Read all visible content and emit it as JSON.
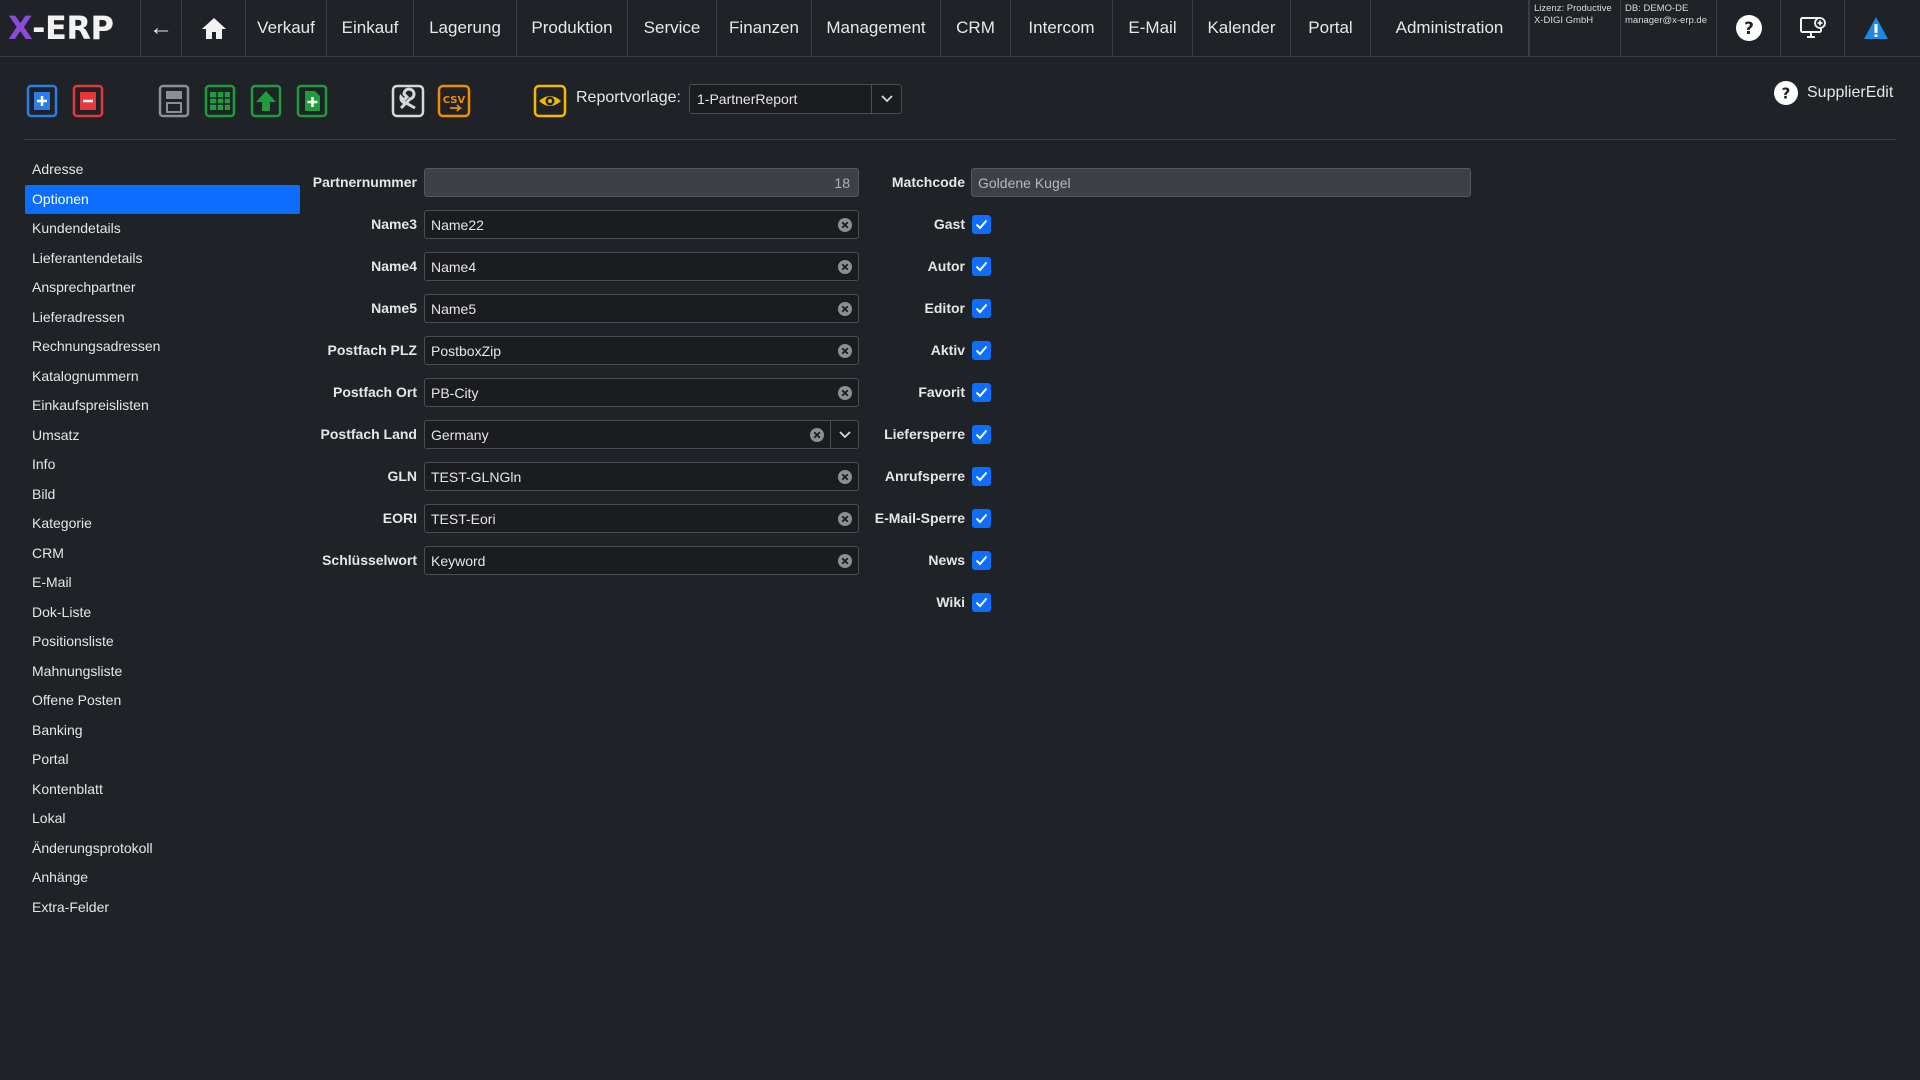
{
  "app": {
    "logo_x": "X",
    "logo_rest": "-ERP"
  },
  "nav": {
    "back": "←",
    "items": [
      "Verkauf",
      "Einkauf",
      "Lagerung",
      "Produktion",
      "Service",
      "Finanzen",
      "Management",
      "CRM",
      "Intercom",
      "E-Mail",
      "Kalender",
      "Portal",
      "Administration"
    ],
    "license_line1": "Lizenz: Productive",
    "license_line2": "X-DIGI GmbH",
    "db_line1": "DB: DEMO-DE",
    "db_line2": "manager@x-erp.de"
  },
  "toolbar": {
    "report_label": "Reportvorlage:",
    "report_value": "1-PartnerReport",
    "help_label": "SupplierEdit",
    "icons": [
      "new-document-icon",
      "delete-document-icon",
      "save-icon",
      "table-icon",
      "upload-icon",
      "add-file-icon",
      "wrench-icon",
      "csv-icon",
      "eye-icon"
    ]
  },
  "sidebar": {
    "items": [
      "Adresse",
      "Optionen",
      "Kundendetails",
      "Lieferantendetails",
      "Ansprechpartner",
      "Lieferadressen",
      "Rechnungsadressen",
      "Katalognummern",
      "Einkaufspreislisten",
      "Umsatz",
      "Info",
      "Bild",
      "Kategorie",
      "CRM",
      "E-Mail",
      "Dok-Liste",
      "Positionsliste",
      "Mahnungsliste",
      "Offene Posten",
      "Banking",
      "Portal",
      "Kontenblatt",
      "Lokal",
      "Änderungsprotokoll",
      "Anhänge",
      "Extra-Felder"
    ],
    "active": "Optionen"
  },
  "form": {
    "partnernummer_label": "Partnernummer",
    "partnernummer_value": "18",
    "matchcode_label": "Matchcode",
    "matchcode_value": "Goldene Kugel",
    "fields": [
      {
        "label": "Name3",
        "value": "Name22"
      },
      {
        "label": "Name4",
        "value": "Name4"
      },
      {
        "label": "Name5",
        "value": "Name5"
      },
      {
        "label": "Postfach PLZ",
        "value": "PostboxZip"
      },
      {
        "label": "Postfach Ort",
        "value": "PB-City"
      },
      {
        "label": "Postfach Land",
        "value": "Germany"
      },
      {
        "label": "GLN",
        "value": "TEST-GLNGln"
      },
      {
        "label": "EORI",
        "value": "TEST-Eori"
      },
      {
        "label": "Schlüsselwort",
        "value": "Keyword"
      }
    ],
    "checkboxes": [
      {
        "label": "Gast",
        "checked": true
      },
      {
        "label": "Autor",
        "checked": true
      },
      {
        "label": "Editor",
        "checked": true
      },
      {
        "label": "Aktiv",
        "checked": true
      },
      {
        "label": "Favorit",
        "checked": true
      },
      {
        "label": "Liefersperre",
        "checked": true
      },
      {
        "label": "Anrufsperre",
        "checked": true
      },
      {
        "label": "E-Mail-Sperre",
        "checked": true
      },
      {
        "label": "News",
        "checked": true
      },
      {
        "label": "Wiki",
        "checked": true
      }
    ]
  },
  "colors": {
    "accent": "#0d6efd",
    "logo_x": "#8a4bd6",
    "background": "#1f2226"
  }
}
